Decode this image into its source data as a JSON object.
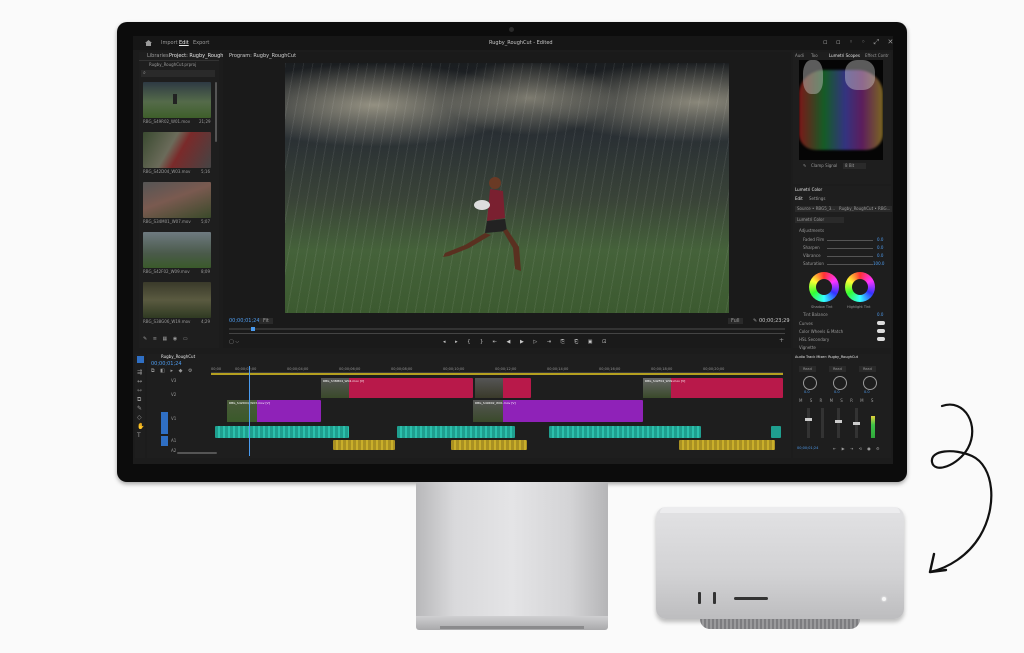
{
  "app": {
    "window_title": "Rugby_RoughCut - Edited",
    "nav_items": [
      "Import",
      "Edit",
      "Export"
    ],
    "active_nav": "Edit"
  },
  "project_panel": {
    "tabs": [
      "Libraries",
      "Project: Rugby_RoughCut"
    ],
    "file_name": "Rugby_RoughCut.prproj",
    "clips": [
      {
        "name": "RBG_S49R02_W01.mov",
        "duration": "21;29"
      },
      {
        "name": "RBG_S42D04_W03.mov",
        "duration": "5;16"
      },
      {
        "name": "RBG_S34M01_W07.mov",
        "duration": "5;07"
      },
      {
        "name": "RBG_S42F02_W09.mov",
        "duration": "8;09"
      },
      {
        "name": "RBG_S38G06_W19.mov",
        "duration": "4;29"
      }
    ]
  },
  "program_monitor": {
    "tab_label": "Program: Rugby_RoughCut",
    "current_timecode": "00;00;01;24",
    "fit_label": "Fit",
    "quality_label": "Full",
    "end_timecode": "00;00;23;29"
  },
  "scopes_panel": {
    "tabs": [
      "Audi",
      "Too",
      "Lumetri Scopes",
      "Effect Contr"
    ],
    "clamp_label": "Clamp Signal",
    "bit_label": "8 Bit"
  },
  "lumetri_color": {
    "title": "Lumetri Color",
    "tabs": [
      "Edit",
      "Settings"
    ],
    "source_label": "Source • RBG5_3...",
    "sequence_label": "Rugby_RoughCut • RBG...",
    "preset_label": "Lumetri Color",
    "section_label": "Adjustments",
    "sliders": [
      {
        "label": "Faded Film",
        "value": "0.0"
      },
      {
        "label": "Sharpen",
        "value": "0.0"
      },
      {
        "label": "Vibrance",
        "value": "0.0"
      },
      {
        "label": "Saturation",
        "value": "100.0"
      }
    ],
    "wheels": [
      "Shadow Tint",
      "Highlight Tint"
    ],
    "tint_balance_label": "Tint Balance",
    "tint_balance_value": "0.0",
    "sections": [
      "Curves",
      "Color Wheels & Match",
      "HSL Secondary",
      "Vignette"
    ]
  },
  "timeline": {
    "tab_label": "Rugby_RoughCut",
    "timecode": "00;00;01;24",
    "ruler": [
      "00;00",
      "00;00;02;00",
      "00;00;04;00",
      "00;00;06;00",
      "00;00;08;00",
      "00;00;10;00",
      "00;00;12;00",
      "00;00;14;00",
      "00;00;16;00",
      "00;00;18;00",
      "00;00;20;00"
    ],
    "tracks": [
      "V3",
      "V2",
      "V1",
      "A1",
      "A2",
      "A3"
    ],
    "clips_v2": [
      "RBG_S38M04_W02.mov [V]",
      "RBG_S44T01_W01.mov",
      "RBG_S42F04_W09.mov [V]"
    ],
    "clips_v1": [
      "RBG_S42D04_W03.mov [V]",
      "RBG_S49R02_W01.mov [V]"
    ]
  },
  "audio_mixer": {
    "title": "Audio Track Mixer: Rugby_RoughCut",
    "read_labels": [
      "Read",
      "Read",
      "Read"
    ],
    "knob_values": [
      "0.0",
      "0.0",
      "0.0"
    ],
    "timecode": "00;00;01;24",
    "end_timecode": "00;00;23;29"
  },
  "colors": {
    "accent": "#4a9bef",
    "v2_clip": "#b8194a",
    "v1_clip": "#8f22b8",
    "audio_teal": "#1f9f8f",
    "audio_yellow": "#a99022"
  }
}
